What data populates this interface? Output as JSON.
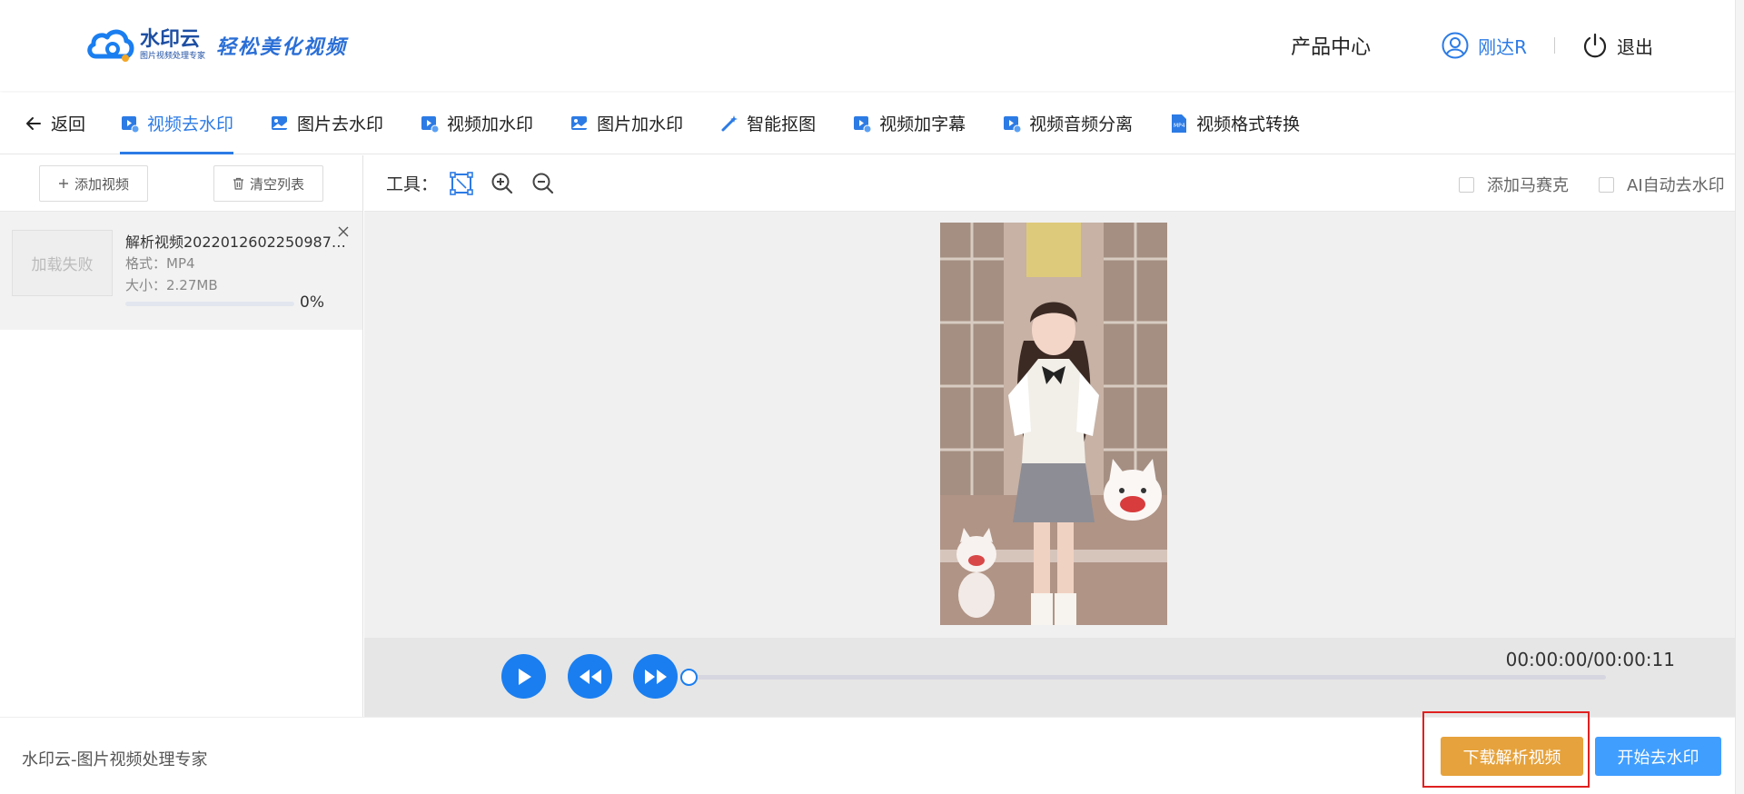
{
  "header": {
    "logo_name": "水印云",
    "logo_sub": "图片视频处理专家",
    "slogan": "轻松美化视频",
    "product_center": "产品中心",
    "username": "刚达R",
    "logout": "退出"
  },
  "nav": {
    "back": "返回",
    "items": [
      {
        "label": "视频去水印",
        "icon": "video-icon",
        "active": true
      },
      {
        "label": "图片去水印",
        "icon": "image-icon"
      },
      {
        "label": "视频加水印",
        "icon": "video-icon"
      },
      {
        "label": "图片加水印",
        "icon": "image-icon"
      },
      {
        "label": "智能抠图",
        "icon": "magic-wand-icon"
      },
      {
        "label": "视频加字幕",
        "icon": "video-icon"
      },
      {
        "label": "视频音频分离",
        "icon": "video-icon"
      },
      {
        "label": "视频格式转换",
        "icon": "mp4-file-icon"
      }
    ]
  },
  "left_panel": {
    "add_video": "添加视频",
    "clear_list": "清空列表",
    "file": {
      "thumb_text": "加载失败",
      "name": "解析视频20220126022509874...",
      "format": "格式：MP4",
      "size": "大小：2.27MB",
      "progress": 0,
      "progress_label": "0%"
    }
  },
  "toolbar": {
    "label": "工具：",
    "mosaic": "添加马赛克",
    "ai_remove": "AI自动去水印"
  },
  "player": {
    "time": "00:00:00/00:00:11",
    "position": 0
  },
  "footer": {
    "text": "水印云-图片视频处理专家",
    "download": "下载解析视频",
    "start": "开始去水印"
  },
  "colors": {
    "accent": "#2c7be5",
    "player_button": "#1a7ef0",
    "download_button": "#e6a23c",
    "start_button": "#409eff",
    "highlight": "#e02020"
  }
}
